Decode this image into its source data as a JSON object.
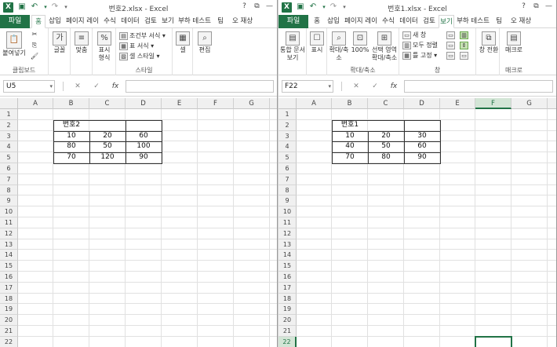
{
  "colors": {
    "accent": "#217346",
    "header_bg": "#f0f0f0",
    "gridline": "#e1e1e1"
  },
  "icons": {
    "excel": "excel-logo-icon",
    "save": "save-icon",
    "undo": "undo-icon",
    "redo": "redo-icon"
  },
  "left": {
    "title": "번호2.xlsx - Excel",
    "logo_letter": "X",
    "tabs": {
      "file": "파일",
      "home": "홈",
      "insert": "삽입",
      "page_layout": "페이지 레이",
      "formulas": "수식",
      "data": "데이터",
      "review": "검토",
      "view": "보기",
      "load_test": "부하 테스트",
      "team": "팀"
    },
    "user": "오 재상",
    "ribbon": {
      "paste": "붙여넣기",
      "clipboard": "클립보드",
      "font": "글꼴",
      "align": "맞춤",
      "number": "표시 형식",
      "cond_format": "조건부 서식",
      "table_format": "표 서식",
      "cell_style": "셀 스타일",
      "style_group": "스타일",
      "cells": "셀",
      "edit": "편집"
    },
    "name_box": "U5",
    "columns": [
      "A",
      "B",
      "C",
      "D",
      "E",
      "F",
      "G"
    ],
    "rows": [
      "1",
      "2",
      "3",
      "4",
      "5",
      "6",
      "7",
      "8",
      "9",
      "10",
      "11",
      "12",
      "13",
      "14",
      "15",
      "16",
      "17",
      "18",
      "19",
      "20",
      "21",
      "22"
    ],
    "table": {
      "header": "번호2",
      "rows": [
        [
          "10",
          "20",
          "60"
        ],
        [
          "80",
          "50",
          "100"
        ],
        [
          "70",
          "120",
          "90"
        ]
      ]
    }
  },
  "right": {
    "title": "번호1.xlsx - Excel",
    "logo_letter": "X",
    "tabs": {
      "file": "파일",
      "home": "홈",
      "insert": "삽입",
      "page_layout": "페이지 레이",
      "formulas": "수식",
      "data": "데이터",
      "review": "검토",
      "view": "보기",
      "load_test": "부하 테스트",
      "team": "팀"
    },
    "user": "오 재상",
    "ribbon": {
      "workbook_views": "통합 문서 보기",
      "show": "표시",
      "zoom": "확대/축소",
      "zoom_100": "100%",
      "zoom_selection": "선택 영역 확대/축소",
      "zoom_group": "확대/축소",
      "new_window": "새 창",
      "arrange_all": "모두 정렬",
      "freeze_panes": "틀 고정",
      "window_group": "창",
      "switch_windows": "창 전환",
      "macros": "매크로",
      "macros_group": "매크로"
    },
    "name_box": "F22",
    "columns": [
      "A",
      "B",
      "C",
      "D",
      "E",
      "F",
      "G"
    ],
    "rows": [
      "1",
      "2",
      "3",
      "4",
      "5",
      "6",
      "7",
      "8",
      "9",
      "10",
      "11",
      "12",
      "13",
      "14",
      "15",
      "16",
      "17",
      "18",
      "19",
      "20",
      "21",
      "22"
    ],
    "table": {
      "header": "번호1",
      "rows": [
        [
          "10",
          "20",
          "30"
        ],
        [
          "40",
          "50",
          "60"
        ],
        [
          "70",
          "80",
          "90"
        ]
      ]
    }
  }
}
